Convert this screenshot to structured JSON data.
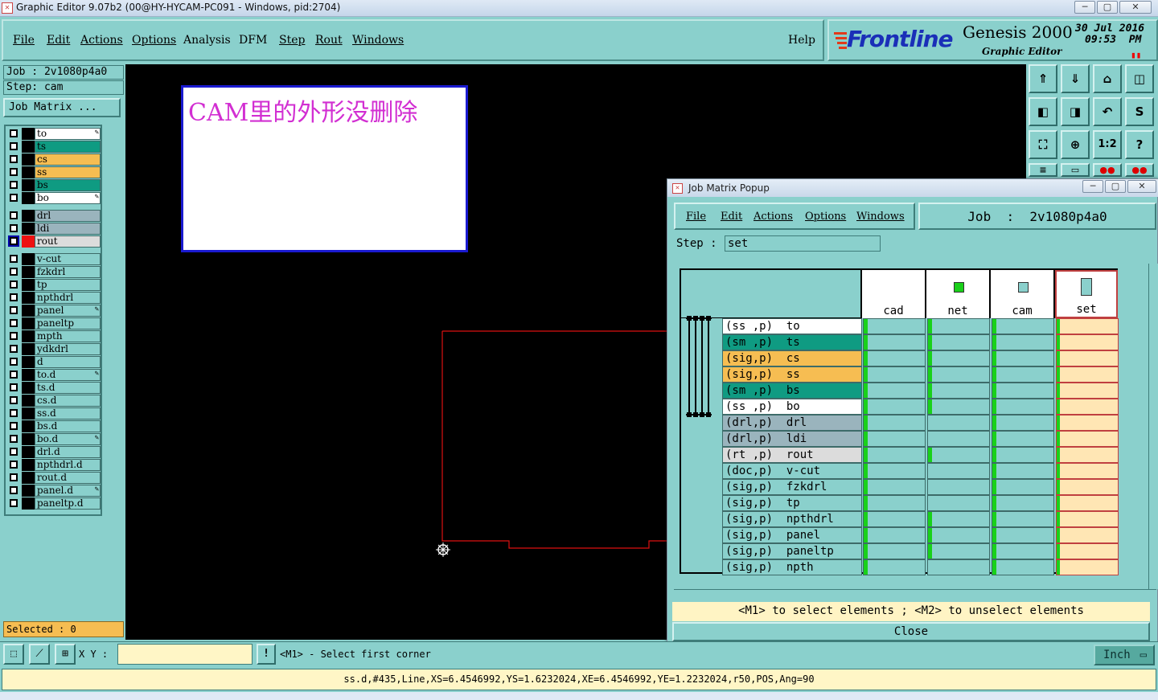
{
  "window": {
    "title": "Graphic Editor 9.07b2 (00@HY-HYCAM-PC091 - Windows, pid:2704)",
    "min": "─",
    "max": "▢",
    "close": "✕"
  },
  "menu": {
    "file": "File",
    "edit": "Edit",
    "actions": "Actions",
    "options": "Options",
    "analysis": "Analysis",
    "dfm": "DFM",
    "step": "Step",
    "rout": "Rout",
    "windows": "Windows",
    "help": "Help"
  },
  "brand": {
    "logo": "Frontline",
    "product": "Genesis 2000",
    "subtitle": "Graphic Editor",
    "date": "30 Jul 2016",
    "time": "09:53  PM"
  },
  "info": {
    "job": "Job : 2v1080p4a0",
    "step": "Step: cam",
    "job_matrix_button": "Job Matrix ..."
  },
  "layers": [
    {
      "name": "to",
      "color": "#ffffff",
      "affected": true
    },
    {
      "name": "ts",
      "color": "#0f9b82",
      "affected": false
    },
    {
      "name": "cs",
      "color": "#f6bd52",
      "affected": false
    },
    {
      "name": "ss",
      "color": "#f6bd52",
      "affected": false
    },
    {
      "name": "bs",
      "color": "#0f9b82",
      "affected": false
    },
    {
      "name": "bo",
      "color": "#ffffff",
      "affected": true
    },
    {
      "name": "drl",
      "color": "#9ab4bd",
      "affected": false
    },
    {
      "name": "ldi",
      "color": "#9ab4bd",
      "affected": false
    },
    {
      "name": "rout",
      "color": "#dcdcdc",
      "affected": false,
      "active": true
    },
    {
      "name": "v-cut",
      "color": "#8ad0cc",
      "affected": false
    },
    {
      "name": "fzkdrl",
      "color": "#8ad0cc",
      "affected": false
    },
    {
      "name": "tp",
      "color": "#8ad0cc",
      "affected": false
    },
    {
      "name": "npthdrl",
      "color": "#8ad0cc",
      "affected": false
    },
    {
      "name": "panel",
      "color": "#8ad0cc",
      "affected": true
    },
    {
      "name": "paneltp",
      "color": "#8ad0cc",
      "affected": false
    },
    {
      "name": "mpth",
      "color": "#8ad0cc",
      "affected": false
    },
    {
      "name": "ydkdrl",
      "color": "#8ad0cc",
      "affected": false
    },
    {
      "name": "d",
      "color": "#8ad0cc",
      "affected": false
    },
    {
      "name": "to.d",
      "color": "#8ad0cc",
      "affected": true
    },
    {
      "name": "ts.d",
      "color": "#8ad0cc",
      "affected": false
    },
    {
      "name": "cs.d",
      "color": "#8ad0cc",
      "affected": false
    },
    {
      "name": "ss.d",
      "color": "#8ad0cc",
      "affected": false
    },
    {
      "name": "bs.d",
      "color": "#8ad0cc",
      "affected": false
    },
    {
      "name": "bo.d",
      "color": "#8ad0cc",
      "affected": true
    },
    {
      "name": "drl.d",
      "color": "#8ad0cc",
      "affected": false
    },
    {
      "name": "npthdrl.d",
      "color": "#8ad0cc",
      "affected": false
    },
    {
      "name": "rout.d",
      "color": "#8ad0cc",
      "affected": false
    },
    {
      "name": "panel.d",
      "color": "#8ad0cc",
      "affected": true
    },
    {
      "name": "paneltp.d",
      "color": "#8ad0cc",
      "affected": false
    }
  ],
  "selected": "Selected : 0",
  "note": "CAM里的外形没删除",
  "popup": {
    "title": "Job Matrix Popup",
    "menu": {
      "file": "File",
      "edit": "Edit",
      "actions": "Actions",
      "options": "Options",
      "windows": "Windows"
    },
    "job": "Job  :  2v1080p4a0",
    "step_label": "Step :",
    "step_value": "set",
    "steps": [
      "cad",
      "net",
      "cam",
      "set"
    ],
    "rows": [
      {
        "label": "(ss ,p)  to",
        "color": "#ffffff",
        "steps": [
          1,
          1,
          1,
          1
        ]
      },
      {
        "label": "(sm ,p)  ts",
        "color": "#0f9b82",
        "steps": [
          1,
          1,
          1,
          1
        ]
      },
      {
        "label": "(sig,p)  cs",
        "color": "#f6bd52",
        "steps": [
          1,
          1,
          1,
          1
        ]
      },
      {
        "label": "(sig,p)  ss",
        "color": "#f6bd52",
        "steps": [
          1,
          1,
          1,
          1
        ]
      },
      {
        "label": "(sm ,p)  bs",
        "color": "#0f9b82",
        "steps": [
          1,
          1,
          1,
          1
        ]
      },
      {
        "label": "(ss ,p)  bo",
        "color": "#ffffff",
        "steps": [
          1,
          1,
          1,
          1
        ]
      },
      {
        "label": "(drl,p)  drl",
        "color": "#9ab4bd",
        "steps": [
          1,
          0,
          1,
          1
        ]
      },
      {
        "label": "(drl,p)  ldi",
        "color": "#9ab4bd",
        "steps": [
          1,
          0,
          1,
          1
        ]
      },
      {
        "label": "(rt ,p)  rout",
        "color": "#dcdcdc",
        "steps": [
          1,
          1,
          1,
          1
        ]
      },
      {
        "label": "(doc,p)  v-cut",
        "color": "#8ad0cc",
        "steps": [
          1,
          0,
          1,
          1
        ]
      },
      {
        "label": "(sig,p)  fzkdrl",
        "color": "#8ad0cc",
        "steps": [
          1,
          0,
          1,
          1
        ]
      },
      {
        "label": "(sig,p)  tp",
        "color": "#8ad0cc",
        "steps": [
          1,
          0,
          1,
          1
        ]
      },
      {
        "label": "(sig,p)  npthdrl",
        "color": "#8ad0cc",
        "steps": [
          1,
          1,
          1,
          1
        ]
      },
      {
        "label": "(sig,p)  panel",
        "color": "#8ad0cc",
        "steps": [
          1,
          1,
          1,
          1
        ]
      },
      {
        "label": "(sig,p)  paneltp",
        "color": "#8ad0cc",
        "steps": [
          1,
          1,
          1,
          1
        ]
      },
      {
        "label": "(sig,p)  npth",
        "color": "#8ad0cc",
        "steps": [
          1,
          0,
          1,
          1
        ]
      }
    ],
    "hint": "<M1> to select elements ; <M2> to unselect elements",
    "close": "Close"
  },
  "bottom": {
    "xy_label": "X Y :",
    "xy_value": "",
    "prompt": "<M1> - Select first corner",
    "unit": "Inch"
  },
  "status": "ss.d,#435,Line,XS=6.4546992,YS=1.6232024,XE=6.4546992,YE=1.2232024,r50,POS,Ang=90"
}
